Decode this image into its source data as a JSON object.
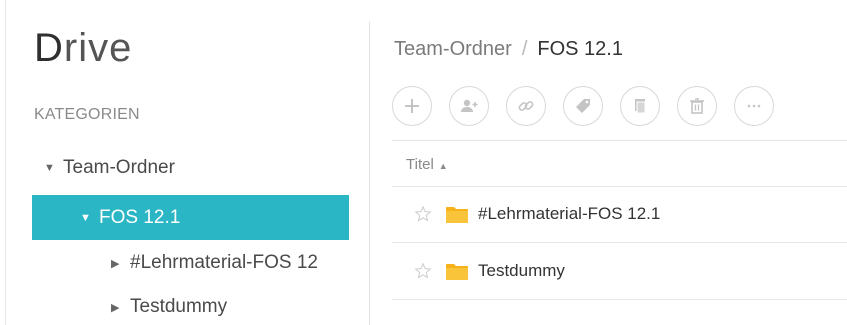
{
  "app": {
    "logo_initial": "D",
    "logo_rest": "rive"
  },
  "sidebar": {
    "section_label": "KATEGORIEN",
    "items": [
      {
        "label": "Team-Ordner",
        "expanded": true
      },
      {
        "label": "FOS 12.1",
        "expanded": true,
        "active": true
      },
      {
        "label": "#Lehrmaterial-FOS 12",
        "expanded": false
      },
      {
        "label": "Testdummy",
        "expanded": false
      }
    ]
  },
  "breadcrumb": {
    "parent": "Team-Ordner",
    "separator": "/",
    "current": "FOS 12.1"
  },
  "toolbar": {
    "buttons": [
      {
        "icon": "plus-icon"
      },
      {
        "icon": "add-user-icon"
      },
      {
        "icon": "link-icon"
      },
      {
        "icon": "tag-icon"
      },
      {
        "icon": "copy-icon"
      },
      {
        "icon": "trash-icon"
      },
      {
        "icon": "more-icon"
      }
    ]
  },
  "table": {
    "column_title": "Titel",
    "sort_indicator": "▲",
    "rows": [
      {
        "name": "#Lehrmaterial-FOS 12.1",
        "icon": "folder-icon"
      },
      {
        "name": "Testdummy",
        "icon": "folder-icon"
      }
    ]
  },
  "colors": {
    "accent": "#2bb6c5",
    "folder": "#f6b21b"
  }
}
